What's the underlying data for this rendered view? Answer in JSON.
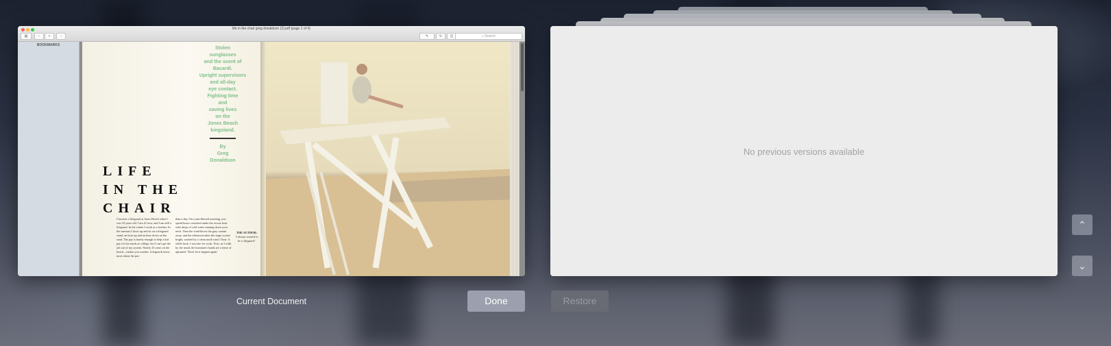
{
  "window": {
    "title": "life in the chair greg donaldson (2).pdf (page 1 of 4)",
    "search_placeholder": "Search",
    "sidebar_label": "BOOKMARKS"
  },
  "document": {
    "deck_lines": [
      "Stolen",
      "sunglasses",
      "and the scent of",
      "Bacardi.",
      "Upright supervisors",
      "and all-day",
      "eye contact.",
      "Fighting time",
      "and",
      "saving lives",
      "on the",
      "Jones Beach",
      "kingsland."
    ],
    "byline": [
      "By",
      "Greg",
      "Donaldson"
    ],
    "headline": [
      "LIFE",
      "IN THE",
      "CHAIR"
    ],
    "body_col1": "I became a lifeguard at Jones Beach when I was 18 years old. I am 41 now, and I am still a lifeguard. In the winter I work as a teacher. In the summer I show up and sit on a lifeguard stand, an hour up and an hour down on the sand. The pay is barely enough to help a kid pay for his meals at college, but I can't get the job out of my system. Nearly 25 years on the beach—makes you wonder. Lifeguards know more about the pas-",
    "body_col2": "than a day. On a rain-blurred morning, you spend hours crouched under the rescue boat, with drops of cold water running down your neck. Then the wind blows the gray curtain away, and the afternoon takes the stage crystal bright, washed by a clean north wind. Time. A while back, I was late for work. Now, as I walk by the stand, the boatman's hands are a tense of upturned. 'Don't let it happen again.'",
    "author_title": "THE AUTHOR:",
    "author_quote": "'I always wanted to be a lifeguard.'"
  },
  "versions": {
    "empty_message": "No previous versions available"
  },
  "footer": {
    "current_label": "Current Document",
    "done_label": "Done",
    "restore_label": "Restore"
  },
  "icons": {
    "up": "chevron-up-icon",
    "down": "chevron-down-icon"
  }
}
